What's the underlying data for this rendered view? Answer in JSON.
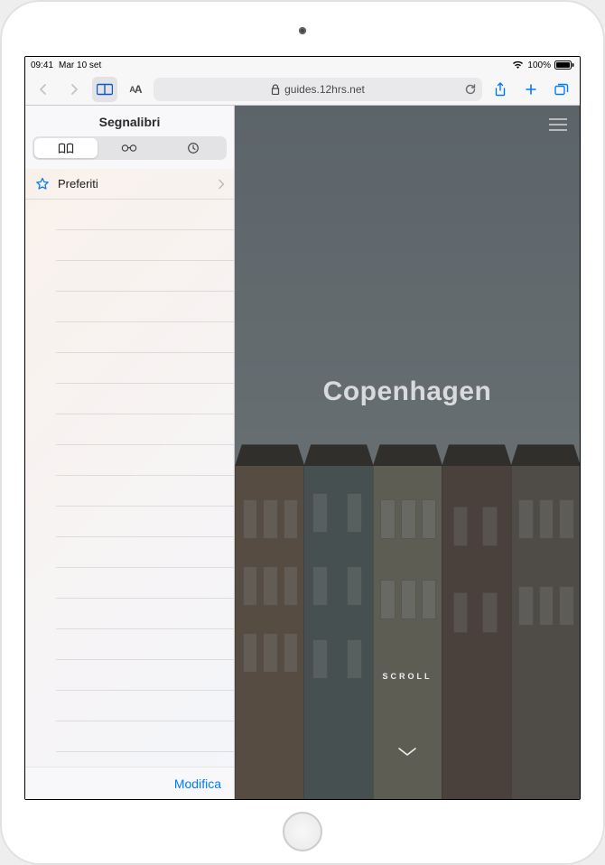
{
  "status": {
    "time": "09:41",
    "date": "Mar 10 set",
    "battery": "100%"
  },
  "toolbar": {
    "url": "guides.12hrs.net"
  },
  "sidebar": {
    "title": "Segnalibri",
    "favorites_label": "Preferiti",
    "edit_label": "Modifica"
  },
  "page": {
    "headline": "Copenhagen",
    "scroll_label": "SCROLL"
  }
}
